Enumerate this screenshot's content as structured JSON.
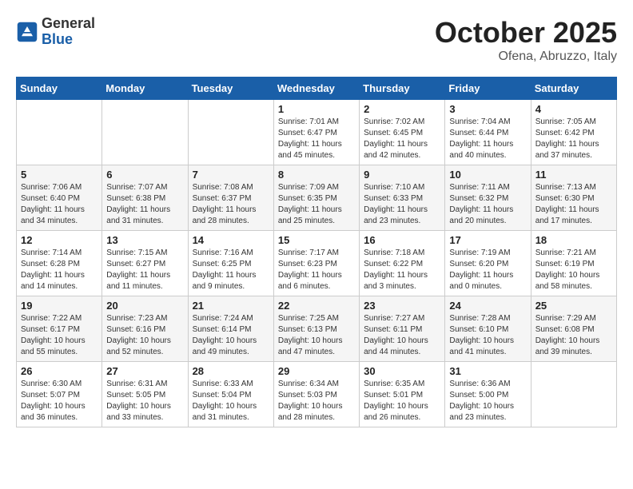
{
  "header": {
    "logo": {
      "general": "General",
      "blue": "Blue"
    },
    "title": "October 2025",
    "location": "Ofena, Abruzzo, Italy"
  },
  "calendar": {
    "days_of_week": [
      "Sunday",
      "Monday",
      "Tuesday",
      "Wednesday",
      "Thursday",
      "Friday",
      "Saturday"
    ],
    "weeks": [
      [
        {
          "day": "",
          "info": ""
        },
        {
          "day": "",
          "info": ""
        },
        {
          "day": "",
          "info": ""
        },
        {
          "day": "1",
          "info": "Sunrise: 7:01 AM\nSunset: 6:47 PM\nDaylight: 11 hours and 45 minutes."
        },
        {
          "day": "2",
          "info": "Sunrise: 7:02 AM\nSunset: 6:45 PM\nDaylight: 11 hours and 42 minutes."
        },
        {
          "day": "3",
          "info": "Sunrise: 7:04 AM\nSunset: 6:44 PM\nDaylight: 11 hours and 40 minutes."
        },
        {
          "day": "4",
          "info": "Sunrise: 7:05 AM\nSunset: 6:42 PM\nDaylight: 11 hours and 37 minutes."
        }
      ],
      [
        {
          "day": "5",
          "info": "Sunrise: 7:06 AM\nSunset: 6:40 PM\nDaylight: 11 hours and 34 minutes."
        },
        {
          "day": "6",
          "info": "Sunrise: 7:07 AM\nSunset: 6:38 PM\nDaylight: 11 hours and 31 minutes."
        },
        {
          "day": "7",
          "info": "Sunrise: 7:08 AM\nSunset: 6:37 PM\nDaylight: 11 hours and 28 minutes."
        },
        {
          "day": "8",
          "info": "Sunrise: 7:09 AM\nSunset: 6:35 PM\nDaylight: 11 hours and 25 minutes."
        },
        {
          "day": "9",
          "info": "Sunrise: 7:10 AM\nSunset: 6:33 PM\nDaylight: 11 hours and 23 minutes."
        },
        {
          "day": "10",
          "info": "Sunrise: 7:11 AM\nSunset: 6:32 PM\nDaylight: 11 hours and 20 minutes."
        },
        {
          "day": "11",
          "info": "Sunrise: 7:13 AM\nSunset: 6:30 PM\nDaylight: 11 hours and 17 minutes."
        }
      ],
      [
        {
          "day": "12",
          "info": "Sunrise: 7:14 AM\nSunset: 6:28 PM\nDaylight: 11 hours and 14 minutes."
        },
        {
          "day": "13",
          "info": "Sunrise: 7:15 AM\nSunset: 6:27 PM\nDaylight: 11 hours and 11 minutes."
        },
        {
          "day": "14",
          "info": "Sunrise: 7:16 AM\nSunset: 6:25 PM\nDaylight: 11 hours and 9 minutes."
        },
        {
          "day": "15",
          "info": "Sunrise: 7:17 AM\nSunset: 6:23 PM\nDaylight: 11 hours and 6 minutes."
        },
        {
          "day": "16",
          "info": "Sunrise: 7:18 AM\nSunset: 6:22 PM\nDaylight: 11 hours and 3 minutes."
        },
        {
          "day": "17",
          "info": "Sunrise: 7:19 AM\nSunset: 6:20 PM\nDaylight: 11 hours and 0 minutes."
        },
        {
          "day": "18",
          "info": "Sunrise: 7:21 AM\nSunset: 6:19 PM\nDaylight: 10 hours and 58 minutes."
        }
      ],
      [
        {
          "day": "19",
          "info": "Sunrise: 7:22 AM\nSunset: 6:17 PM\nDaylight: 10 hours and 55 minutes."
        },
        {
          "day": "20",
          "info": "Sunrise: 7:23 AM\nSunset: 6:16 PM\nDaylight: 10 hours and 52 minutes."
        },
        {
          "day": "21",
          "info": "Sunrise: 7:24 AM\nSunset: 6:14 PM\nDaylight: 10 hours and 49 minutes."
        },
        {
          "day": "22",
          "info": "Sunrise: 7:25 AM\nSunset: 6:13 PM\nDaylight: 10 hours and 47 minutes."
        },
        {
          "day": "23",
          "info": "Sunrise: 7:27 AM\nSunset: 6:11 PM\nDaylight: 10 hours and 44 minutes."
        },
        {
          "day": "24",
          "info": "Sunrise: 7:28 AM\nSunset: 6:10 PM\nDaylight: 10 hours and 41 minutes."
        },
        {
          "day": "25",
          "info": "Sunrise: 7:29 AM\nSunset: 6:08 PM\nDaylight: 10 hours and 39 minutes."
        }
      ],
      [
        {
          "day": "26",
          "info": "Sunrise: 6:30 AM\nSunset: 5:07 PM\nDaylight: 10 hours and 36 minutes."
        },
        {
          "day": "27",
          "info": "Sunrise: 6:31 AM\nSunset: 5:05 PM\nDaylight: 10 hours and 33 minutes."
        },
        {
          "day": "28",
          "info": "Sunrise: 6:33 AM\nSunset: 5:04 PM\nDaylight: 10 hours and 31 minutes."
        },
        {
          "day": "29",
          "info": "Sunrise: 6:34 AM\nSunset: 5:03 PM\nDaylight: 10 hours and 28 minutes."
        },
        {
          "day": "30",
          "info": "Sunrise: 6:35 AM\nSunset: 5:01 PM\nDaylight: 10 hours and 26 minutes."
        },
        {
          "day": "31",
          "info": "Sunrise: 6:36 AM\nSunset: 5:00 PM\nDaylight: 10 hours and 23 minutes."
        },
        {
          "day": "",
          "info": ""
        }
      ]
    ]
  }
}
